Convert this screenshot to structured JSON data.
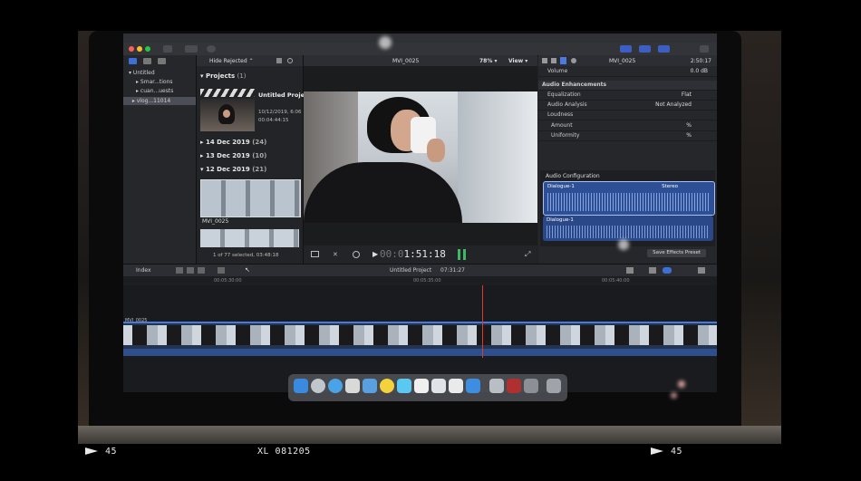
{
  "app": {
    "library_items": [
      "Untitled",
      "Smar...tions",
      "cuan...uests",
      "vlog...11014"
    ],
    "filter_label": "Hide Rejected",
    "projects_header": "Projects",
    "projects_count": "(1)",
    "project_name": "Untitled Project",
    "project_date": "10/12/2019, 6:06",
    "project_duration": "00:04:44:15",
    "date_groups": [
      {
        "label": "14 Dec 2019",
        "count": "(24)"
      },
      {
        "label": "13 Dec 2019",
        "count": "(10)"
      },
      {
        "label": "12 Dec 2019",
        "count": "(21)"
      }
    ],
    "clip_name": "MVI_0025",
    "selection_status": "1 of 77 selected, 03:48:18"
  },
  "viewer": {
    "clip_title": "MVI_0025",
    "zoom": "78%",
    "view_label": "View",
    "timecode_dim": "00:0",
    "timecode": "1:51:18"
  },
  "inspector": {
    "clip_name": "MVI_0025",
    "duration": "2:50:17",
    "volume_label": "Volume",
    "volume_value": "0.0 dB",
    "enhancements_label": "Audio Enhancements",
    "equalization_label": "Equalization",
    "equalization_value": "Flat",
    "analysis_label": "Audio Analysis",
    "analysis_value": "Not Analyzed",
    "loudness_label": "Loudness",
    "amount_label": "Amount",
    "amount_unit": "%",
    "uniformity_label": "Uniformity",
    "uniformity_unit": "%",
    "config_label": "Audio Configuration",
    "channel_top": "Dialogue-1",
    "channel_top_mode": "Stereo",
    "channel_bottom": "Dialogue-1",
    "save_label": "Save Effects Preset"
  },
  "timeline": {
    "index_label": "Index",
    "project_name": "Untitled Project",
    "project_duration": "07:31:27",
    "ruler_marks": [
      "00:05:30:00",
      "00:05:35:00",
      "00:05:40:00"
    ],
    "clip_label": "MVI_0025"
  },
  "film": {
    "left_frame": "45",
    "center_code": "XL 081205",
    "right_frame": "45"
  }
}
